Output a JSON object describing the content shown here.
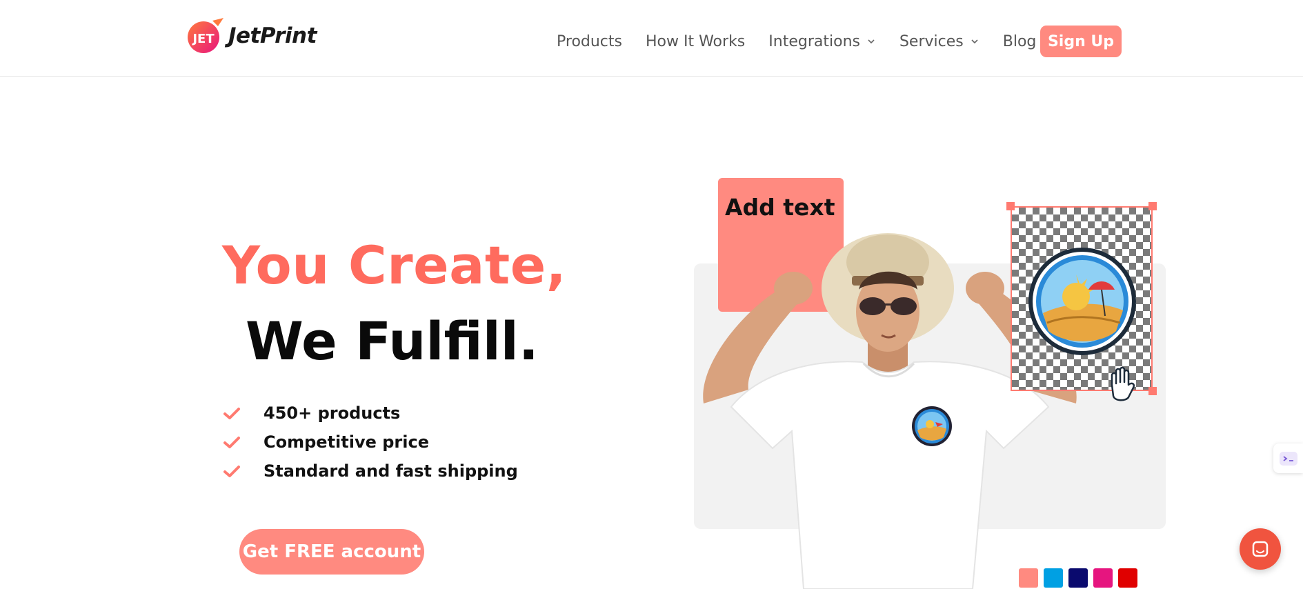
{
  "brand": {
    "name": "JetPrint",
    "logo_mark_text": "JET",
    "accent_color": "#ff8a80",
    "headline_color": "#ff6b5e"
  },
  "nav": {
    "items": [
      {
        "label": "Products",
        "has_dropdown": false
      },
      {
        "label": "How It Works",
        "has_dropdown": false
      },
      {
        "label": "Integrations",
        "has_dropdown": true
      },
      {
        "label": "Services",
        "has_dropdown": true
      },
      {
        "label": "Blog",
        "has_dropdown": false
      }
    ],
    "signup_label": "Sign Up"
  },
  "hero": {
    "headline_line1": "You Create,",
    "headline_line2": "We Fulfill.",
    "features": [
      "450+ products",
      "Competitive price",
      "Standard and fast shipping"
    ],
    "cta_label": "Get FREE account"
  },
  "illustration": {
    "add_text_label": "Add text",
    "swatch_colors": [
      "#ff8a80",
      "#00a0e3",
      "#0a0a6e",
      "#e6157f",
      "#e00000"
    ]
  },
  "icons": {
    "chevron": "chevron-down-icon",
    "check": "check-icon",
    "chat": "chat-icon",
    "hand": "hand-cursor-icon"
  }
}
